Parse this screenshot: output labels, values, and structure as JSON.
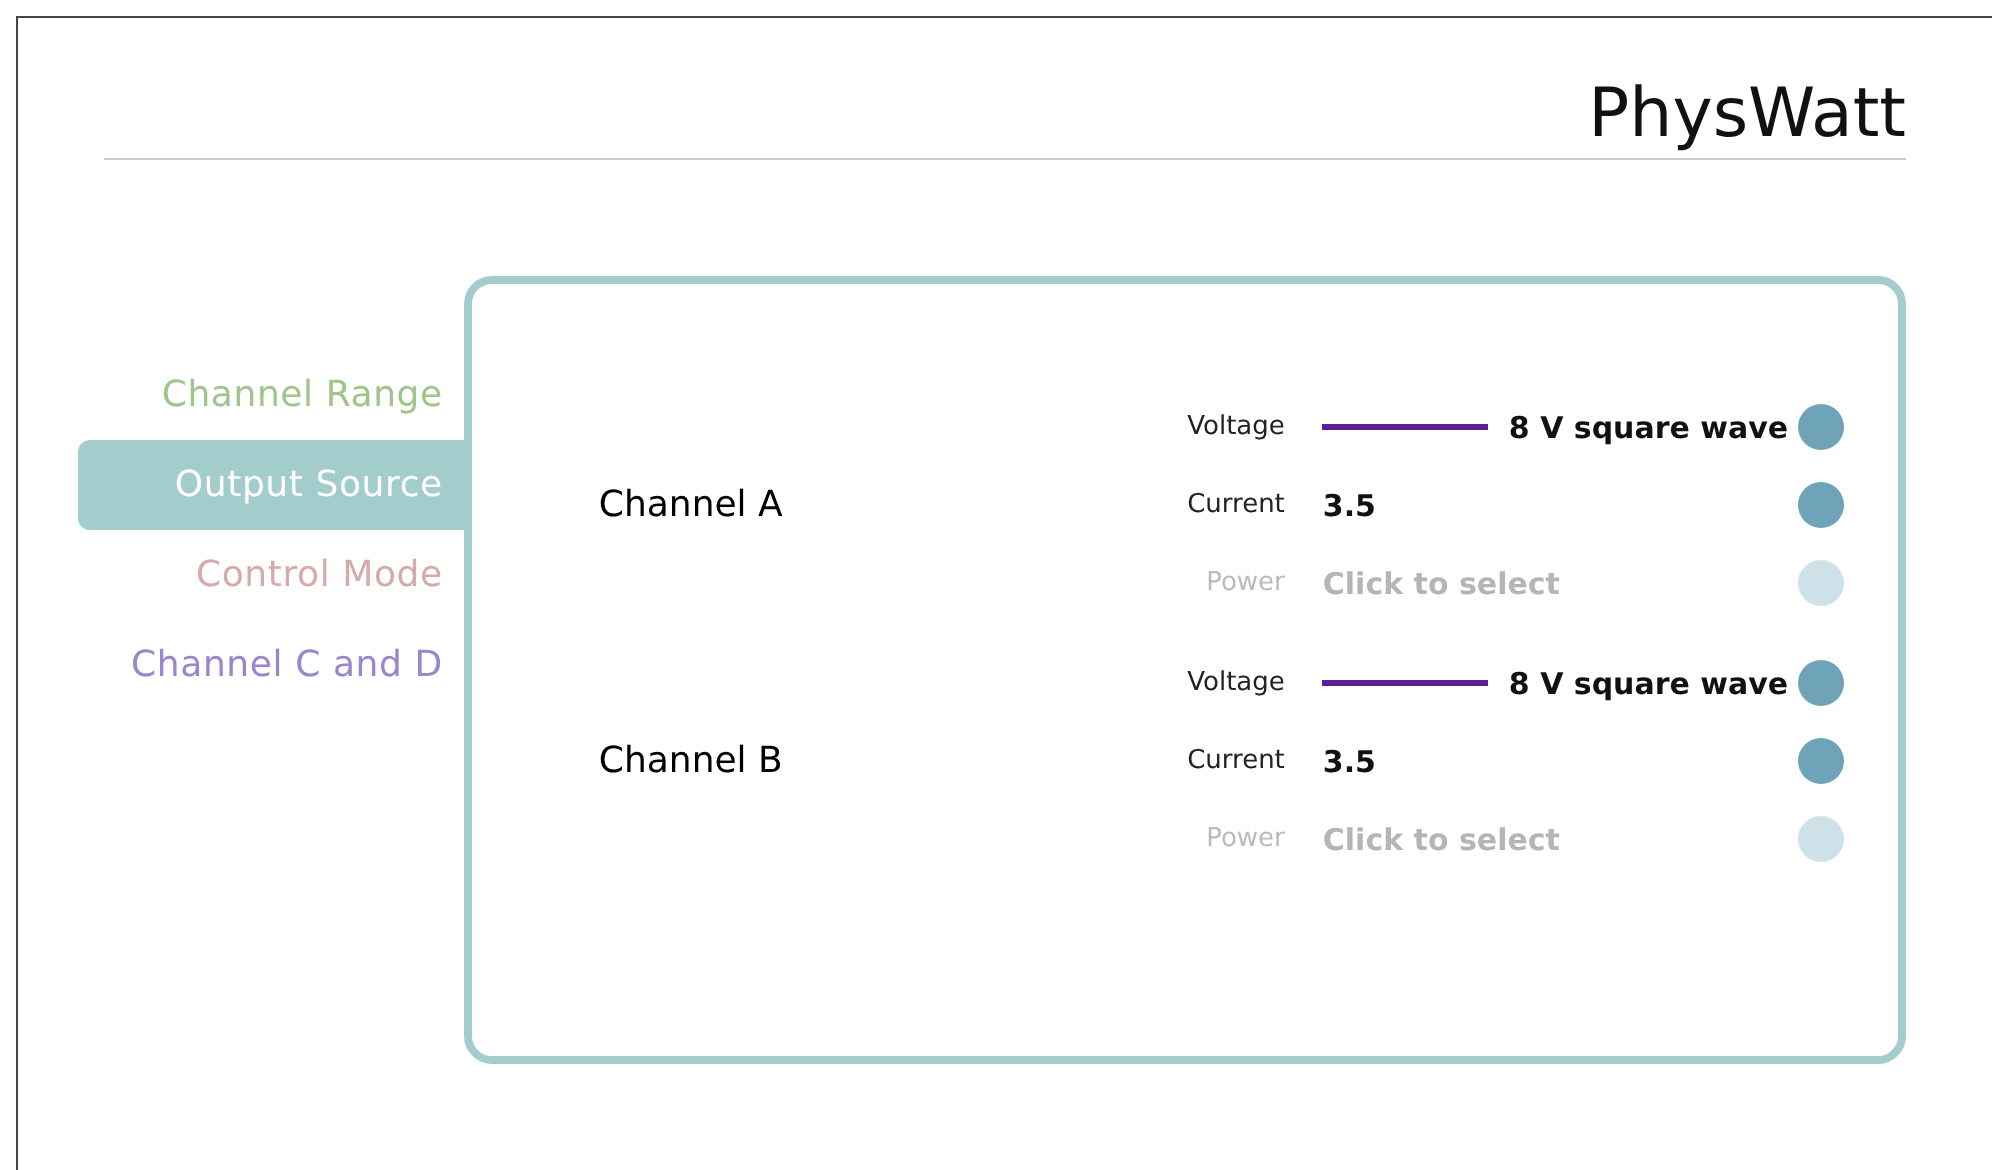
{
  "title": "PhysWatt",
  "nav": [
    {
      "label": "Channel Range",
      "selected": false,
      "color": "#9fc58a"
    },
    {
      "label": "Output Source",
      "selected": true
    },
    {
      "label": "Control Mode",
      "selected": false,
      "color": "#d4aaaa"
    },
    {
      "label": "Channel C and D",
      "selected": false,
      "color": "#9a86cc"
    }
  ],
  "channels": [
    {
      "name": "Channel A",
      "rows": [
        {
          "kind": "line",
          "label": "Voltage",
          "value": "8 V square wave",
          "disabled": false
        },
        {
          "kind": "text",
          "label": "Current",
          "value": "3.5",
          "disabled": false
        },
        {
          "kind": "text",
          "label": "Power",
          "value": "Click to select",
          "disabled": true
        }
      ]
    },
    {
      "name": "Channel B",
      "rows": [
        {
          "kind": "line",
          "label": "Voltage",
          "value": "8 V square wave",
          "disabled": false
        },
        {
          "kind": "text",
          "label": "Current",
          "value": "3.5",
          "disabled": false
        },
        {
          "kind": "text",
          "label": "Power",
          "value": "Click to select",
          "disabled": true
        }
      ]
    }
  ]
}
